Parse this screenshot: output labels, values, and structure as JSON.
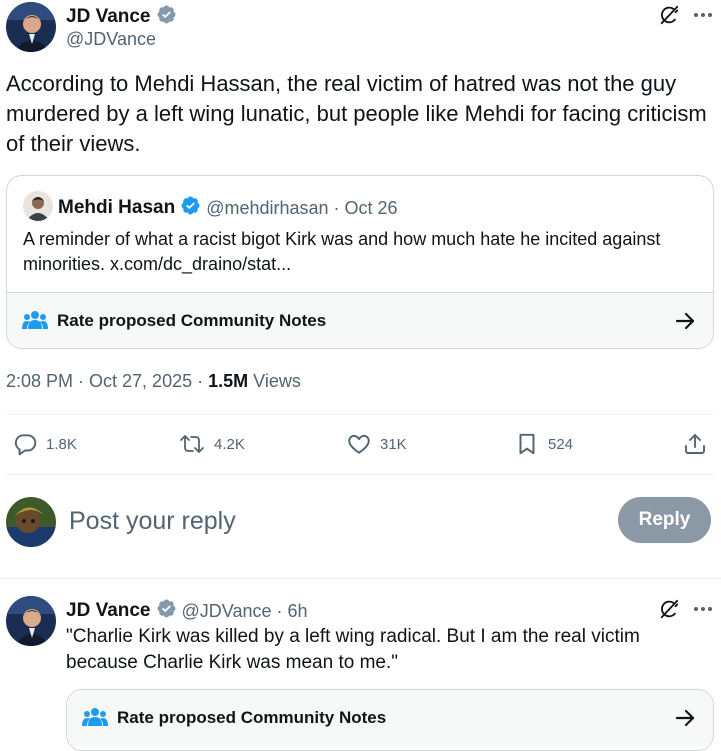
{
  "main_post": {
    "author_name": "JD Vance",
    "author_handle": "@JDVance",
    "text": "According to Mehdi Hassan, the real victim of hatred was not the guy murdered by a left wing lunatic, but people like Mehdi for facing criticism of their views.",
    "timestamp": "2:08 PM · Oct 27, 2025 · ",
    "views_count": "1.5M",
    "views_label": "Views"
  },
  "quoted_post": {
    "author_name": "Mehdi Hasan",
    "author_handle": "@mehdirhasan",
    "date": "· Oct 26",
    "text": "A reminder of what a racist bigot Kirk was and how much hate he incited against minorities. x.com/dc_draino/stat..."
  },
  "community_notes": {
    "label": "Rate proposed Community Notes"
  },
  "actions": {
    "replies": "1.8K",
    "reposts": "4.2K",
    "likes": "31K",
    "bookmarks": "524"
  },
  "composer": {
    "placeholder": "Post your reply",
    "reply_button": "Reply"
  },
  "reply_post": {
    "author_name": "JD Vance",
    "author_handle": "@JDVance",
    "time": "· 6h",
    "text": "\"Charlie Kirk was killed by a left wing radical. But I am the real victim because Charlie Kirk was mean to me.\""
  },
  "colors": {
    "verified_gray": "#829aab",
    "verified_blue": "#1d9bf0",
    "muted": "#536471",
    "reply_button_bg": "#8b98a5"
  },
  "icons": [
    "grok-icon",
    "more-icon",
    "verified-badge-icon",
    "people-icon",
    "arrow-right-icon",
    "reply-icon",
    "repost-icon",
    "like-icon",
    "bookmark-icon",
    "share-icon"
  ]
}
